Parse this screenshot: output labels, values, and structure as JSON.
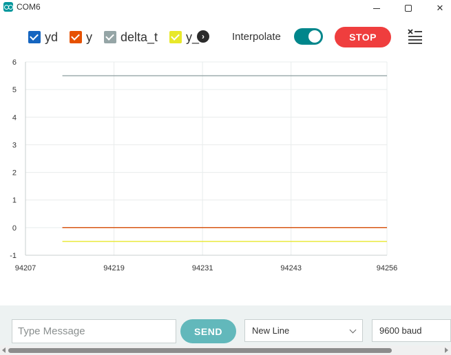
{
  "window": {
    "title": "COM6"
  },
  "legend": {
    "items": [
      {
        "label": "yd",
        "color": "#1565c0"
      },
      {
        "label": "y",
        "color": "#e65100"
      },
      {
        "label": "delta_t",
        "color": "#95a5a6"
      },
      {
        "label": "y_",
        "color": "#e8e82a"
      }
    ],
    "more_icon": "chevron-right-icon"
  },
  "controls": {
    "interpolate_label": "Interpolate",
    "interpolate_on": true,
    "stop_label": "STOP",
    "clear_icon": "clear-list-icon"
  },
  "chart_data": {
    "type": "line",
    "ylim": [
      -1,
      6
    ],
    "yticks": [
      "6",
      "5",
      "4",
      "3",
      "2",
      "1",
      "0",
      "-1"
    ],
    "xlim": [
      94207,
      94256
    ],
    "xticks": [
      "94207",
      "94219",
      "94231",
      "94243",
      "94256"
    ],
    "grid": true,
    "series": [
      {
        "name": "yd",
        "color": "#1565c0",
        "x": [
          94212,
          94256
        ],
        "y": [
          0,
          0
        ]
      },
      {
        "name": "y",
        "color": "#e65100",
        "x": [
          94212,
          94256
        ],
        "y": [
          0,
          0
        ]
      },
      {
        "name": "delta_t",
        "color": "#95a5a6",
        "x": [
          94212,
          94256
        ],
        "y": [
          5.5,
          5.5
        ]
      },
      {
        "name": "y_",
        "color": "#e8e82a",
        "x": [
          94212,
          94256
        ],
        "y": [
          -0.5,
          -0.5
        ]
      }
    ]
  },
  "footer": {
    "message_placeholder": "Type Message",
    "send_label": "SEND",
    "line_ending": "New Line",
    "baud": "9600 baud"
  }
}
